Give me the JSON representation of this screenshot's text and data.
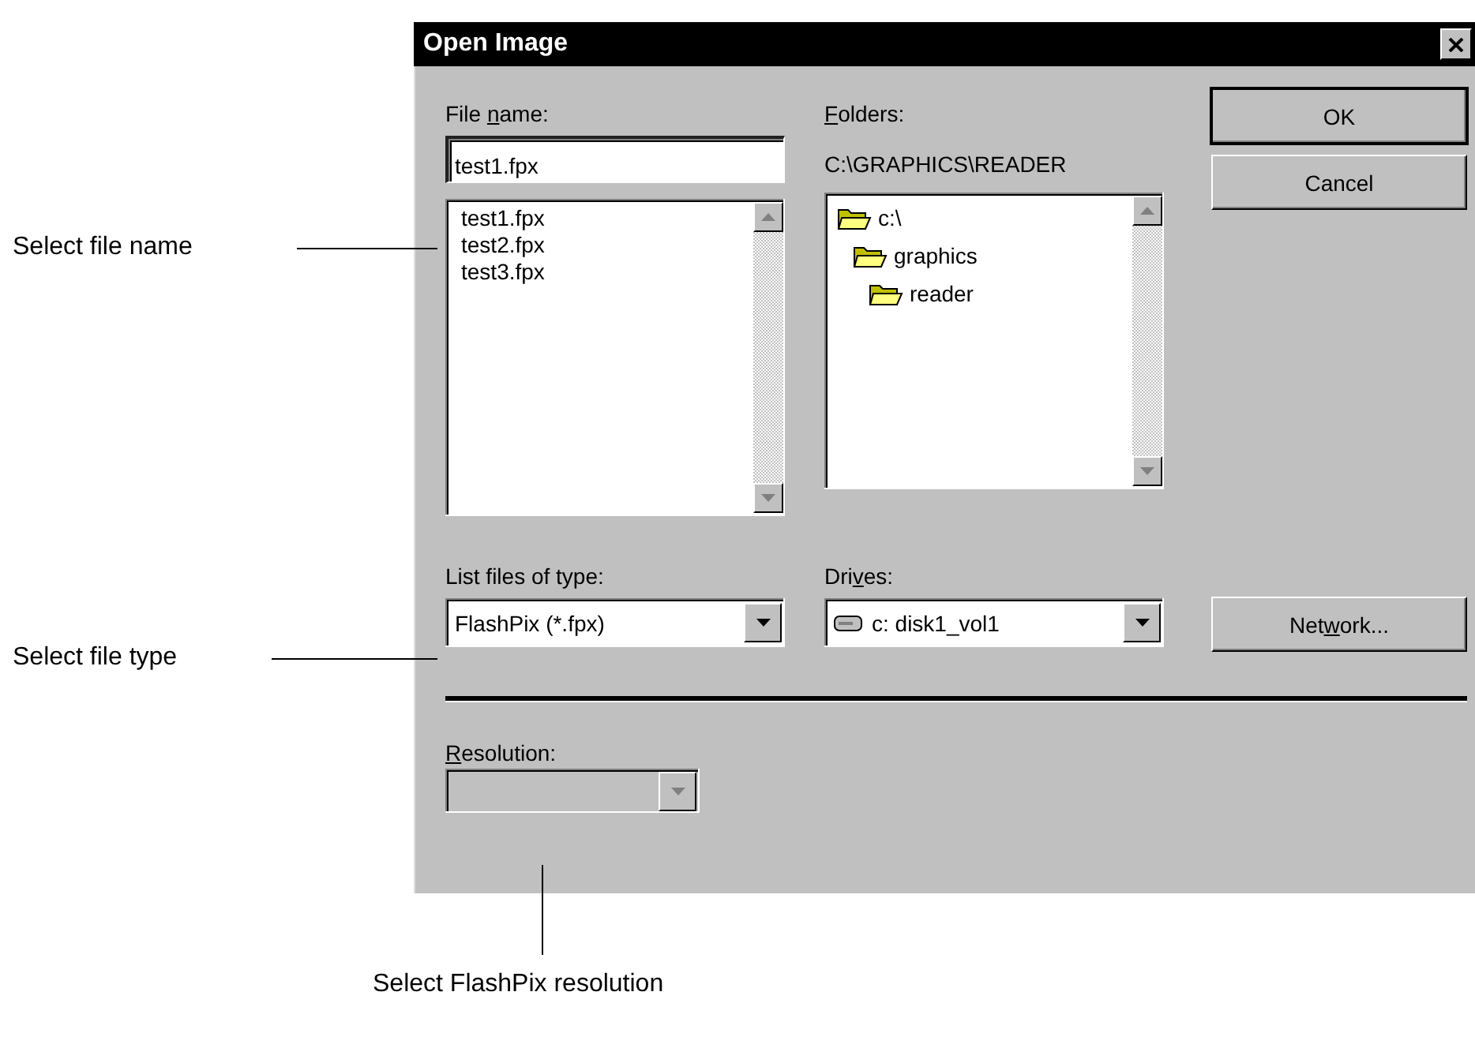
{
  "window": {
    "title": "Open Image"
  },
  "file_name": {
    "label": {
      "before": "File ",
      "key": "n",
      "after": "ame:"
    },
    "value": "test1.fpx"
  },
  "files": [
    {
      "name": "test1.fpx",
      "selected": false
    },
    {
      "name": "test2.fpx",
      "selected": false
    },
    {
      "name": "test3.fpx",
      "selected": false
    }
  ],
  "folders": {
    "label": {
      "key": "F",
      "after": "olders:"
    },
    "path": "C:\\GRAPHICS\\READER",
    "tree": [
      {
        "name": "c:\\",
        "children": [
          {
            "name": "graphics",
            "children": [
              {
                "name": "reader"
              }
            ]
          }
        ]
      }
    ]
  },
  "file_type": {
    "label": {
      "before": "List files of type:"
    },
    "value": "FlashPix (*.fpx)"
  },
  "drives": {
    "label": {
      "before": "Dri",
      "key": "v",
      "after": "es:"
    },
    "value": "c: disk1_vol1"
  },
  "buttons": [
    {
      "label": {
        "before": "OK"
      },
      "default": true
    },
    {
      "label": {
        "before": "Cancel"
      },
      "default": false
    }
  ],
  "network_button": {
    "label": {
      "before": "Net",
      "key": "w",
      "after": "ork..."
    },
    "default": false
  },
  "resolution": {
    "label": {
      "key": "R",
      "after": "esolution:"
    },
    "disabled": true
  },
  "annotations": [
    {
      "text": "Select file name"
    },
    {
      "text": "Select file type"
    },
    {
      "text": "Select FlashPix resolution"
    }
  ]
}
